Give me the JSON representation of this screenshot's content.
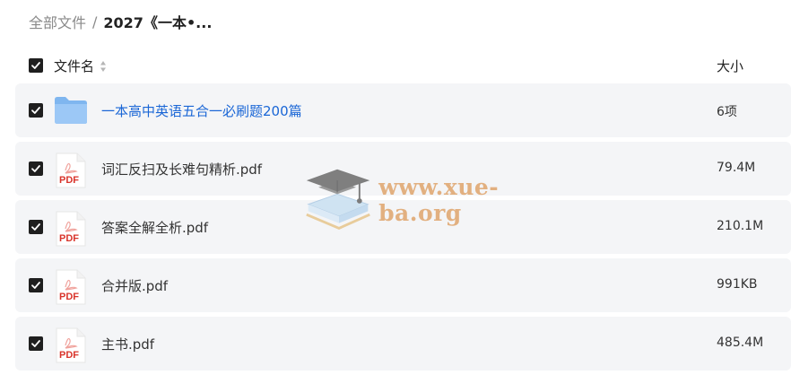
{
  "breadcrumb": {
    "root": "全部文件",
    "separator": "/",
    "current": "2027《一本•..."
  },
  "header": {
    "name_label": "文件名",
    "size_label": "大小"
  },
  "files": [
    {
      "name": "一本高中英语五合一必刷题200篇",
      "size": "6项",
      "type": "folder"
    },
    {
      "name": "词汇反扫及长难句精析.pdf",
      "size": "79.4M",
      "type": "pdf"
    },
    {
      "name": "答案全解全析.pdf",
      "size": "210.1M",
      "type": "pdf"
    },
    {
      "name": "合并版.pdf",
      "size": "991KB",
      "type": "pdf"
    },
    {
      "name": "主书.pdf",
      "size": "485.4M",
      "type": "pdf"
    }
  ],
  "pdf_icon_label": "PDF",
  "watermark": {
    "text": "www.xue-ba.org",
    "color": "#e0a56c"
  },
  "colors": {
    "folder_link": "#1a66d6",
    "row_bg": "#f4f5f7",
    "checkbox": "#1f1f1f",
    "pdf_red": "#d9342b"
  }
}
